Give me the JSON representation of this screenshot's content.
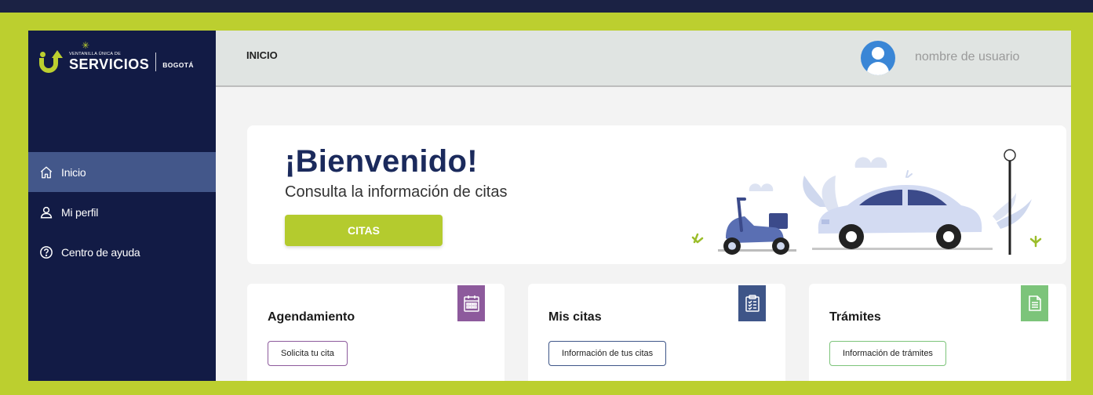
{
  "logo": {
    "top_text": "VENTANILLA ÚNICA DE",
    "main_text": "SERVICIOS",
    "city_text": "BOGOTÁ"
  },
  "sidebar": {
    "items": [
      {
        "label": "Inicio",
        "icon": "home-icon",
        "active": true
      },
      {
        "label": "Mi perfil",
        "icon": "user-icon",
        "active": false
      },
      {
        "label": "Centro de ayuda",
        "icon": "help-icon",
        "active": false
      }
    ]
  },
  "topbar": {
    "breadcrumb": "INICIO",
    "user_name": "nombre de usuario"
  },
  "hero": {
    "title": "¡Bienvenido!",
    "subtitle": "Consulta la información de citas",
    "button_label": "CITAS"
  },
  "cards": [
    {
      "title": "Agendamiento",
      "button_label": "Solicita tu cita",
      "icon": "calendar-icon",
      "color": "#8d5a9c"
    },
    {
      "title": "Mis citas",
      "button_label": "Información de tus citas",
      "icon": "clipboard-icon",
      "color": "#3e5588"
    },
    {
      "title": "Trámites",
      "button_label": "Información de trámites",
      "icon": "document-icon",
      "color": "#7cc47a"
    }
  ],
  "colors": {
    "sidebar_bg": "#121b45",
    "accent_green": "#b4cb2e",
    "active_item": "#43578a",
    "title_blue": "#1b2a5c"
  }
}
